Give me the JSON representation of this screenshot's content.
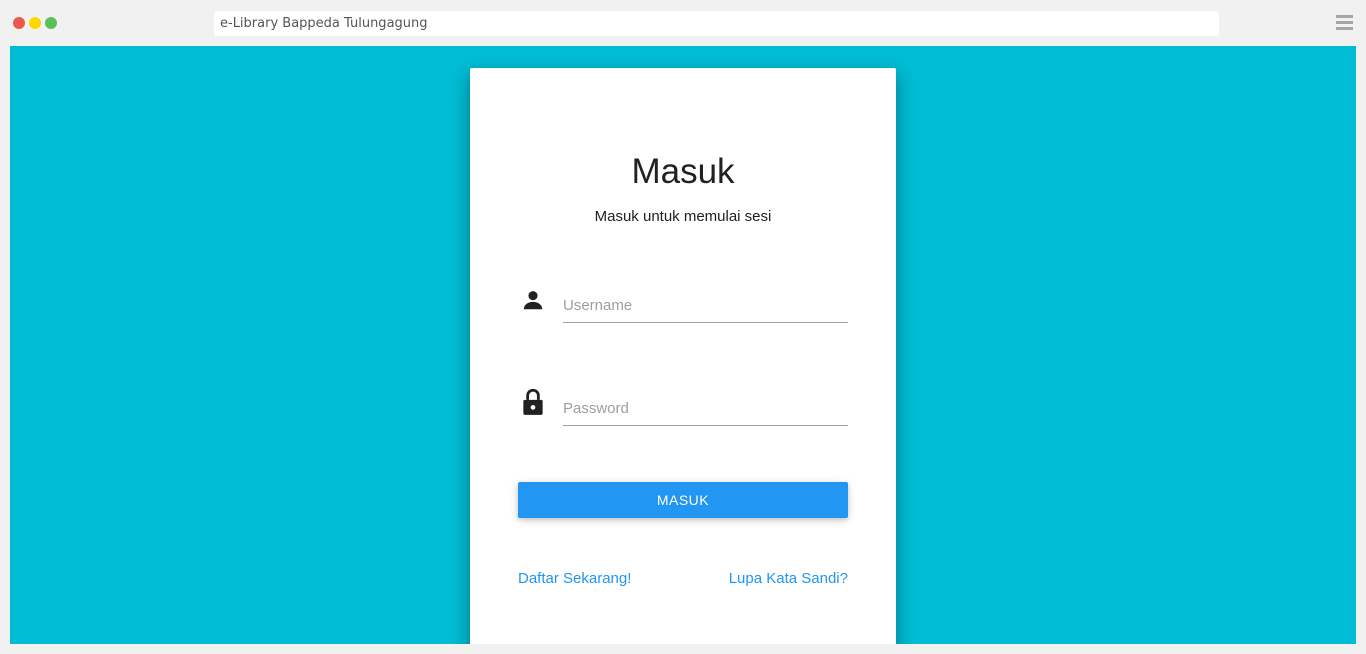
{
  "browser": {
    "address": "e-Library Bappeda Tulungagung",
    "icons": [
      "close-dot",
      "minimize-dot",
      "maximize-dot",
      "hamburger-menu-icon"
    ]
  },
  "colors": {
    "background": "#00bcd4",
    "card": "#ffffff",
    "primary": "#2196f3",
    "text": "#212121"
  },
  "login": {
    "title": "Masuk",
    "subtitle": "Masuk untuk memulai sesi",
    "username": {
      "placeholder": "Username",
      "value": "",
      "icon": "person-icon"
    },
    "password": {
      "placeholder": "Password",
      "value": "",
      "icon": "lock-icon"
    },
    "submit_label": "MASUK",
    "register_link": "Daftar Sekarang!",
    "forgot_link": "Lupa Kata Sandi?"
  }
}
